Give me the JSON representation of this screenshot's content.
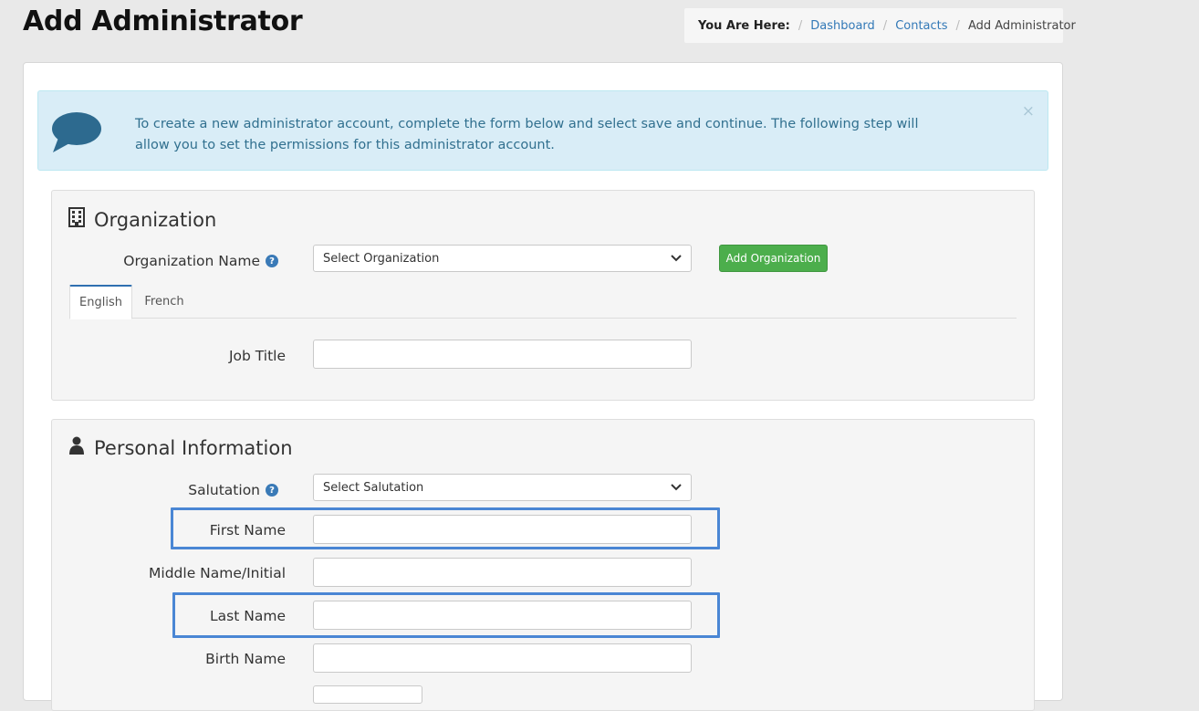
{
  "header": {
    "title": "Add Administrator"
  },
  "breadcrumb": {
    "label": "You Are Here:",
    "links": [
      "Dashboard",
      "Contacts"
    ],
    "current": "Add Administrator"
  },
  "alert": {
    "text": "To create a new administrator account, complete the form below and select save and continue. The following step will allow you to set the permissions for this administrator account.",
    "close": "×"
  },
  "organization": {
    "title": "Organization",
    "org_name_label": "Organization Name",
    "org_select_value": "Select Organization",
    "add_button": "Add Organization",
    "tabs": [
      "English",
      "French"
    ],
    "job_title_label": "Job Title",
    "job_title_value": ""
  },
  "personal": {
    "title": "Personal Information",
    "salutation_label": "Salutation",
    "salutation_value": "Select Salutation",
    "first_name_label": "First Name",
    "middle_name_label": "Middle Name/Initial",
    "last_name_label": "Last Name",
    "birth_name_label": "Birth Name"
  },
  "colors": {
    "accent_blue": "#3379b7",
    "alert_bg": "#d9edf7",
    "green_button": "#4cae4c",
    "highlight": "#4a86d4"
  }
}
